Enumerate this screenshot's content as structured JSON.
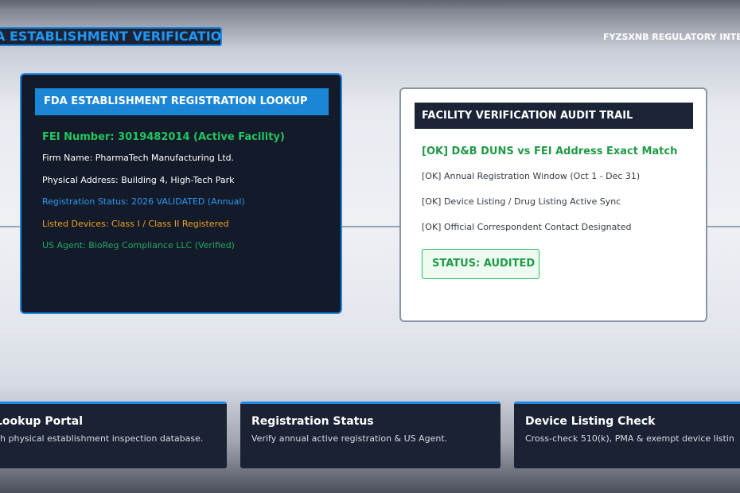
{
  "header": {
    "title": "A ESTABLISHMENT VERIFICATION",
    "brand": "FYZSXNB REGULATORY INTELL"
  },
  "lookup_card": {
    "heading": "FDA ESTABLISHMENT REGISTRATION LOOKUP",
    "fei": "FEI Number: 3019482014 (Active Facility)",
    "firm": "Firm Name: PharmaTech Manufacturing Ltd.",
    "address": "Physical Address: Building 4, High-Tech Park",
    "registration": "Registration Status: 2026 VALIDATED (Annual)",
    "devices": "Listed Devices: Class I / Class II Registered",
    "agent": "US Agent: BioReg Compliance LLC (Verified)"
  },
  "audit_card": {
    "heading": "FACILITY VERIFICATION AUDIT TRAIL",
    "main_check": "[OK] D&B DUNS vs FEI Address Exact Match",
    "checks": [
      "[OK] Annual Registration Window (Oct 1 - Dec 31)",
      "[OK] Device Listing / Drug Listing Active Sync",
      "[OK] Official Correspondent Contact Designated"
    ],
    "status": "STATUS: AUDITED"
  },
  "features": [
    {
      "title": "Lookup Portal",
      "desc": "ch physical establishment inspection database."
    },
    {
      "title": "Registration Status",
      "desc": "Verify annual active registration & US Agent."
    },
    {
      "title": "Device Listing Check",
      "desc": "Cross-check 510(k), PMA & exempt device listin"
    }
  ],
  "colors": {
    "accent_blue": "#1e88e5",
    "ok_green": "#22c55e",
    "warning_amber": "#f0a21e",
    "dark_navy": "#131a2a"
  }
}
